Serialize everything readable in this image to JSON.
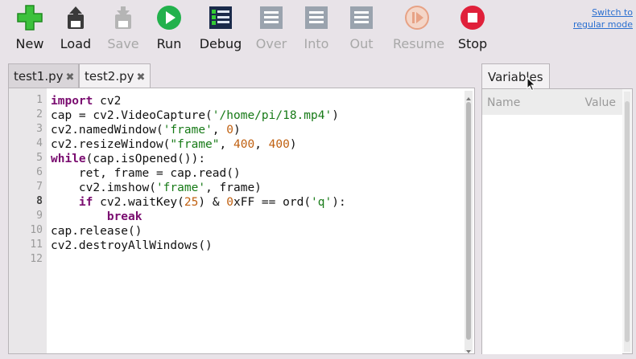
{
  "toolbar": {
    "buttons": [
      {
        "id": "new",
        "label": "New",
        "icon": "plus-icon",
        "enabled": true
      },
      {
        "id": "load",
        "label": "Load",
        "icon": "load-icon",
        "enabled": true
      },
      {
        "id": "save",
        "label": "Save",
        "icon": "save-icon",
        "enabled": false
      },
      {
        "id": "run",
        "label": "Run",
        "icon": "play-icon",
        "enabled": true
      },
      {
        "id": "debug",
        "label": "Debug",
        "icon": "debug-icon",
        "enabled": true
      },
      {
        "id": "over",
        "label": "Over",
        "icon": "step-over-icon",
        "enabled": false
      },
      {
        "id": "into",
        "label": "Into",
        "icon": "step-into-icon",
        "enabled": false
      },
      {
        "id": "out",
        "label": "Out",
        "icon": "step-out-icon",
        "enabled": false
      },
      {
        "id": "resume",
        "label": "Resume",
        "icon": "resume-icon",
        "enabled": false
      },
      {
        "id": "stop",
        "label": "Stop",
        "icon": "stop-icon",
        "enabled": true
      }
    ],
    "switch_link_line1": "Switch to",
    "switch_link_line2": "regular mode"
  },
  "tabs": [
    {
      "label": "test1.py",
      "active": false
    },
    {
      "label": "test2.py",
      "active": true
    }
  ],
  "tab_close_glyph": "✖",
  "editor": {
    "current_line": 8,
    "line_numbers": [
      "1",
      "2",
      "3",
      "4",
      "5",
      "6",
      "7",
      "8",
      "9",
      "10",
      "11",
      "12"
    ]
  },
  "variables": {
    "tab_label": "Variables",
    "col_name": "Name",
    "col_value": "Value"
  },
  "colors": {
    "accent_green": "#33b833",
    "run_green": "#22b14c",
    "stop_red": "#e0203a",
    "keyword": "#7a0d70",
    "string": "#177a17",
    "number": "#c06010"
  }
}
